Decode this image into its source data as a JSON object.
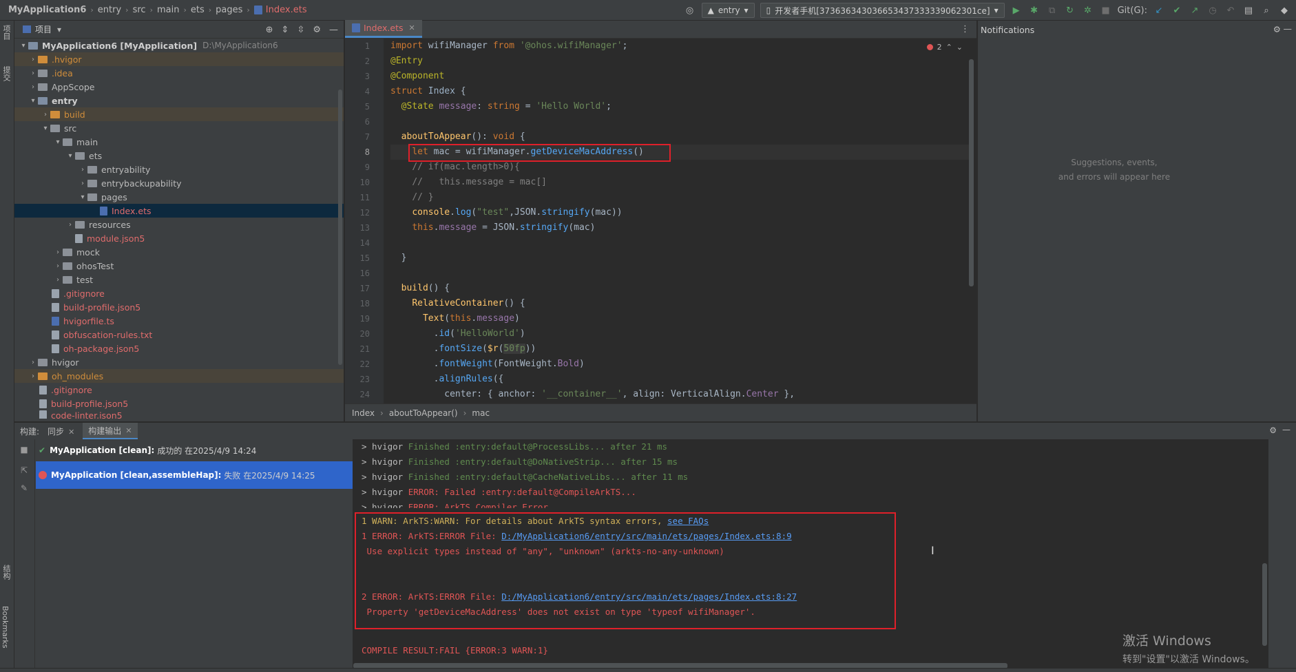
{
  "topbar": {
    "breadcrumb": [
      "MyApplication6",
      "entry",
      "src",
      "main",
      "ets",
      "pages",
      "Index.ets"
    ],
    "run_config": "entry",
    "device": "开发者手机[373636343036653437333339062301ce]",
    "git_label": "Git(G):"
  },
  "left_stripe": {
    "project": "项目",
    "commit": "提交",
    "structure": "结构",
    "bookmarks": "Bookmarks"
  },
  "project": {
    "title": "项目",
    "tree": [
      {
        "label": "MyApplication6 [MyApplication]",
        "path": "D:\\MyApplication6"
      },
      {
        "label": ".hvigor"
      },
      {
        "label": ".idea"
      },
      {
        "label": "AppScope"
      },
      {
        "label": "entry"
      },
      {
        "label": "build"
      },
      {
        "label": "src"
      },
      {
        "label": "main"
      },
      {
        "label": "ets"
      },
      {
        "label": "entryability"
      },
      {
        "label": "entrybackupability"
      },
      {
        "label": "pages"
      },
      {
        "label": "Index.ets"
      },
      {
        "label": "resources"
      },
      {
        "label": "module.json5"
      },
      {
        "label": "mock"
      },
      {
        "label": "ohosTest"
      },
      {
        "label": "test"
      },
      {
        "label": ".gitignore"
      },
      {
        "label": "build-profile.json5"
      },
      {
        "label": "hvigorfile.ts"
      },
      {
        "label": "obfuscation-rules.txt"
      },
      {
        "label": "oh-package.json5"
      },
      {
        "label": "hvigor"
      },
      {
        "label": "oh_modules"
      },
      {
        "label": ".gitignore"
      },
      {
        "label": "build-profile.json5"
      },
      {
        "label": "code-linter.json5"
      }
    ]
  },
  "editor": {
    "tab": "Index.ets",
    "error_count": "2",
    "line_numbers": [
      "1",
      "2",
      "3",
      "4",
      "5",
      "6",
      "7",
      "8",
      "9",
      "10",
      "11",
      "12",
      "13",
      "14",
      "15",
      "16",
      "17",
      "18",
      "19",
      "20",
      "21",
      "22",
      "23",
      "24"
    ],
    "breadcrumbs": [
      "Index",
      "aboutToAppear()",
      "mac"
    ]
  },
  "notifications": {
    "title": "Notifications",
    "empty_line1": "Suggestions, events,",
    "empty_line2": "and errors will appear here"
  },
  "build": {
    "label": "构建:",
    "tab_sync": "同步",
    "tab_output": "构建输出",
    "runs": [
      {
        "name": "MyApplication [clean]:",
        "status": "成功的 在2025/4/9 14:24",
        "result": "success"
      },
      {
        "name": "MyApplication [clean,assembleHap]:",
        "status": "失败 在2025/4/9 14:25",
        "result": "failed"
      }
    ],
    "console": {
      "l1": "> hvigor ",
      "l1b": "Finished :entry:default@ProcessLibs... after 21 ms",
      "l2": "> hvigor ",
      "l2b": "Finished :entry:default@DoNativeStrip... after 15 ms",
      "l3": "> hvigor ",
      "l3b": "Finished :entry:default@CacheNativeLibs... after 11 ms",
      "l4": "> hvigor ",
      "l4b": "ERROR: Failed :entry:default@CompileArkTS...",
      "l5": "> hvigor ",
      "l5b": "ERROR: ArkTS Compiler Error",
      "warn": "1 WARN: ArkTS:WARN: For details about ArkTS syntax errors, ",
      "warn_link": "see FAQs",
      "err1": "1 ERROR: ArkTS:ERROR File: ",
      "err1_link": "D:/MyApplication6/entry/src/main/ets/pages/Index.ets:8:9",
      "err1_msg": " Use explicit types instead of \"any\", \"unknown\" (arkts-no-any-unknown)",
      "err2": "2 ERROR: ArkTS:ERROR File: ",
      "err2_link": "D:/MyApplication6/entry/src/main/ets/pages/Index.ets:8:27",
      "err2_msg": " Property 'getDeviceMacAddress' does not exist on type 'typeof wifiManager'.",
      "result": "COMPILE RESULT:FAIL {ERROR:3 WARN:1}"
    }
  },
  "watermark": {
    "line1": "激活 Windows",
    "line2": "转到\"设置\"以激活 Windows。"
  },
  "colors": {
    "error_box": "#e0202a",
    "accent": "#4a88c7",
    "selected_run": "#2f65ca"
  }
}
